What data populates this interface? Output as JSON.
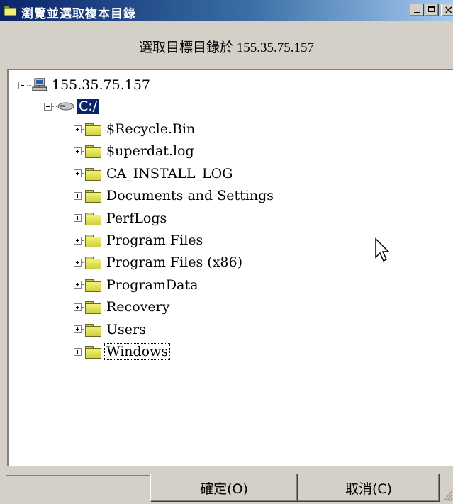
{
  "window": {
    "title": "瀏覽並選取複本目錄",
    "subtitle_prefix": "選取目標目錄於 ",
    "subtitle_host": "155.35.75.157",
    "controls": {
      "minimize": "_",
      "maximize": "□",
      "close": "×"
    }
  },
  "tree": {
    "root": {
      "label": "155.35.75.157",
      "icon": "computer-icon"
    },
    "drive": {
      "label": "C:/",
      "icon": "drive-icon",
      "selected": true
    },
    "folders": [
      "$Recycle.Bin",
      "$uperdat.log",
      "CA_INSTALL_LOG",
      "Documents and Settings",
      "PerfLogs",
      "Program Files",
      "Program Files (x86)",
      "ProgramData",
      "Recovery",
      "Users",
      "Windows"
    ],
    "focused_folder": "Windows"
  },
  "buttons": {
    "ok": "確定(O)",
    "cancel": "取消(C)"
  },
  "colors": {
    "title_bar": "#0a246a",
    "selection": "#0a246a",
    "dialog_bg": "#d4d0c8",
    "folder": "#e6e65a"
  }
}
